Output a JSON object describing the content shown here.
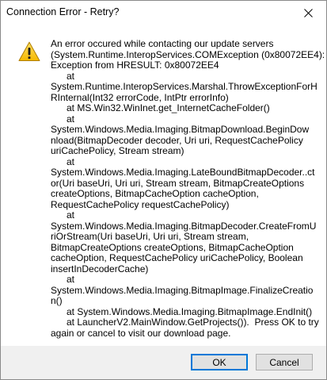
{
  "window": {
    "title": "Connection Error - Retry?",
    "close_icon": "close-icon"
  },
  "message": {
    "icon": "warning-icon",
    "text": "An error occured while contacting our update servers\n(System.Runtime.InteropServices.COMException (0x80072EE4):\nException from HRESULT: 0x80072EE4\n      at\nSystem.Runtime.InteropServices.Marshal.ThrowExceptionForH\nRInternal(Int32 errorCode, IntPtr errorInfo)\n      at MS.Win32.WinInet.get_InternetCacheFolder()\n      at\nSystem.Windows.Media.Imaging.BitmapDownload.BeginDow\nnload(BitmapDecoder decoder, Uri uri, RequestCachePolicy\nuriCachePolicy, Stream stream)\n      at\nSystem.Windows.Media.Imaging.LateBoundBitmapDecoder..ct\nor(Uri baseUri, Uri uri, Stream stream, BitmapCreateOptions\ncreateOptions, BitmapCacheOption cacheOption,\nRequestCachePolicy requestCachePolicy)\n      at\nSystem.Windows.Media.Imaging.BitmapDecoder.CreateFromU\nriOrStream(Uri baseUri, Uri uri, Stream stream,\nBitmapCreateOptions createOptions, BitmapCacheOption\ncacheOption, RequestCachePolicy uriCachePolicy, Boolean\ninsertInDecoderCache)\n      at\nSystem.Windows.Media.Imaging.BitmapImage.FinalizeCreatio\nn()\n      at System.Windows.Media.Imaging.BitmapImage.EndInit()\n      at LauncherV2.MainWindow.GetProjects()).  Press OK to try\nagain or cancel to visit our download page."
  },
  "buttons": {
    "ok_label": "OK",
    "cancel_label": "Cancel",
    "default_accent": "#0078d7"
  }
}
